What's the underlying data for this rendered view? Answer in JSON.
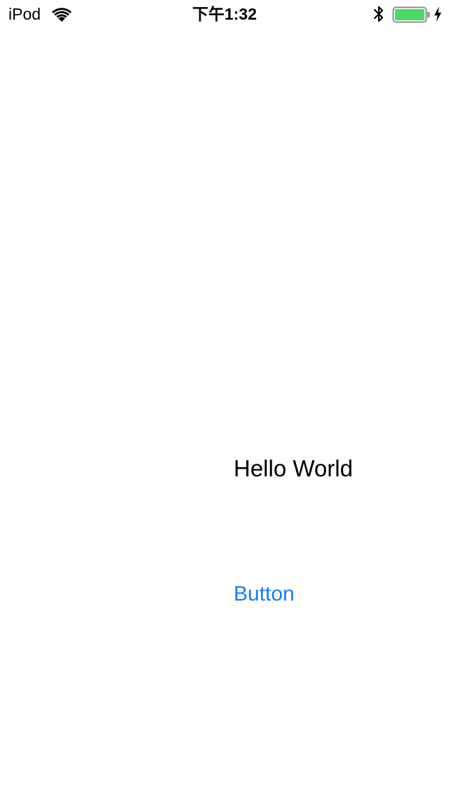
{
  "status_bar": {
    "carrier": "iPod",
    "time": "下午1:32",
    "icons": {
      "wifi": "wifi-icon",
      "bluetooth": "bluetooth-icon",
      "battery": "battery-icon",
      "charging": "charging-bolt-icon"
    },
    "battery_level": 1.0,
    "battery_color": "#4cd964"
  },
  "main": {
    "label_text": "Hello World",
    "button_label": "Button",
    "button_color": "#147efb"
  }
}
